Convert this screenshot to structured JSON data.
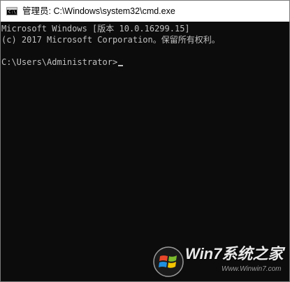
{
  "window": {
    "title": "管理员: C:\\Windows\\system32\\cmd.exe",
    "icon": "cmd-icon"
  },
  "console": {
    "lines": [
      "Microsoft Windows [版本 10.0.16299.15]",
      "(c) 2017 Microsoft Corporation。保留所有权利。"
    ],
    "prompt": "C:\\Users\\Administrator>"
  },
  "watermark": {
    "brand": "Win7系统之家",
    "url": "Www.Winwin7.com"
  },
  "colors": {
    "console_background": "#0c0c0c",
    "console_text": "#c0c0c0",
    "titlebar_background": "#ffffff"
  }
}
